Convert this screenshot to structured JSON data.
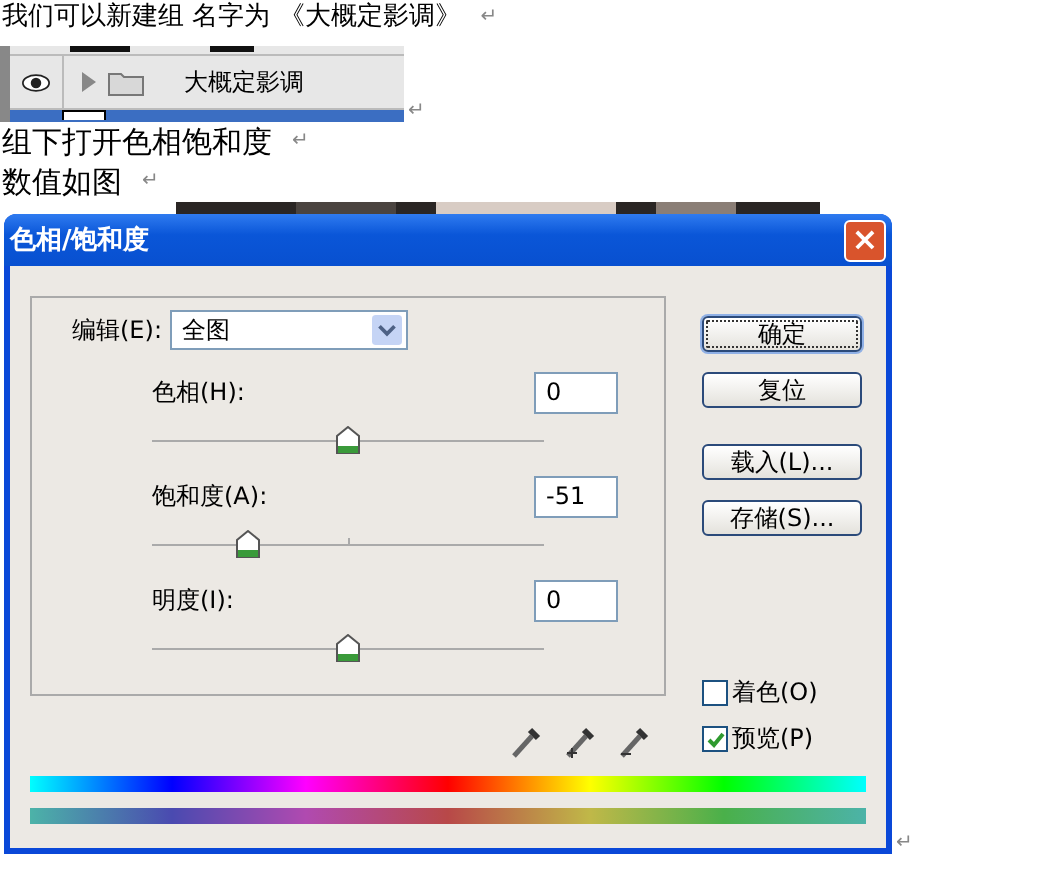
{
  "paragraphs": [
    {
      "text": "我们可以新建组  名字为 《大概定影调》",
      "mark": "↵"
    }
  ],
  "layers_panel": {
    "layer": {
      "name": "大概定影调",
      "visible": true,
      "expanded": false
    },
    "mark": "↵"
  },
  "paragraphs_after": [
    {
      "text": "组下打开色相饱和度",
      "mark": "↵"
    },
    {
      "text": "数值如图",
      "mark": "↵"
    }
  ],
  "dialog": {
    "title": "色相/饱和度",
    "close": "×",
    "edit": {
      "label": "编辑(E):",
      "value": "全图"
    },
    "sliders": [
      {
        "label": "色相(H):",
        "value": "0",
        "level": 0.5
      },
      {
        "label": "饱和度(A):",
        "value": "-51",
        "level": 0.245
      },
      {
        "label": "明度(I):",
        "value": "0",
        "level": 0.5
      }
    ],
    "buttons": [
      {
        "label": "确定",
        "default": true
      },
      {
        "label": "复位",
        "default": false
      },
      {
        "label": "载入(L)...",
        "default": false
      },
      {
        "label": "存储(S)...",
        "default": false
      }
    ],
    "checkboxes": [
      {
        "label": "着色(O)",
        "checked": false
      },
      {
        "label": "预览(P)",
        "checked": true
      }
    ]
  },
  "end_mark": "↵"
}
